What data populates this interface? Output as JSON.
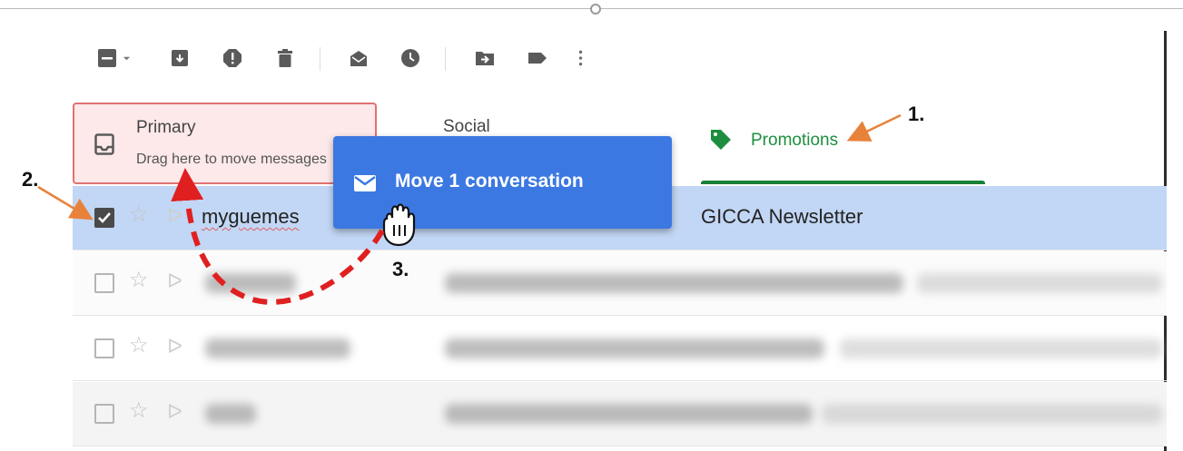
{
  "toolbar": {
    "icons": [
      "select-checkbox-icon",
      "dropdown-caret-icon",
      "archive-icon",
      "report-spam-icon",
      "delete-icon",
      "mark-as-read-icon",
      "snooze-icon",
      "move-to-icon",
      "label-icon",
      "more-options-icon"
    ]
  },
  "tabs": {
    "primary": {
      "label": "Primary",
      "hint": "Drag here to move messages"
    },
    "social": {
      "label": "Social"
    },
    "promotions": {
      "label": "Promotions"
    }
  },
  "selected_row": {
    "sender": "myguemes",
    "subject": "GICCA Newsletter"
  },
  "drag_popup": {
    "label": "Move 1 conversation"
  },
  "annotations": {
    "one": "1.",
    "two": "2.",
    "three": "3."
  },
  "colors": {
    "accent_blue": "#3c78e2",
    "selected_row": "#c2d7f5",
    "promotions_green": "#1e8e3e",
    "drop_target_border": "#e07272",
    "annotation_arrow": "#e8823a",
    "drag_path": "#e02020"
  }
}
